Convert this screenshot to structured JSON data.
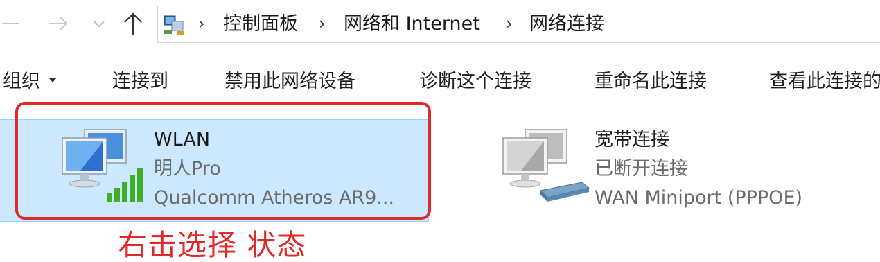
{
  "breadcrumb": {
    "items": [
      "控制面板",
      "网络和 Internet",
      "网络连接"
    ]
  },
  "toolbar": {
    "organize_label": "组织",
    "connect_label": "连接到",
    "disable_label": "禁用此网络设备",
    "diagnose_label": "诊断这个连接",
    "rename_label": "重命名此连接",
    "view_label": "查看此连接的"
  },
  "connections": [
    {
      "name": "WLAN",
      "status": "明人Pro",
      "device": "Qualcomm Atheros AR9...",
      "selected": true,
      "icon": "wifi-adapter-icon"
    },
    {
      "name": "宽带连接",
      "status": "已断开连接",
      "device": "WAN Miniport (PPPOE)",
      "selected": false,
      "icon": "broadband-adapter-icon"
    }
  ],
  "annotation": {
    "text": "右击选择 状态",
    "color": "#e02a2a"
  },
  "colors": {
    "selection_bg": "#cce8ff",
    "selection_border": "#99d1ff",
    "signal_green": "#3fae2a"
  }
}
